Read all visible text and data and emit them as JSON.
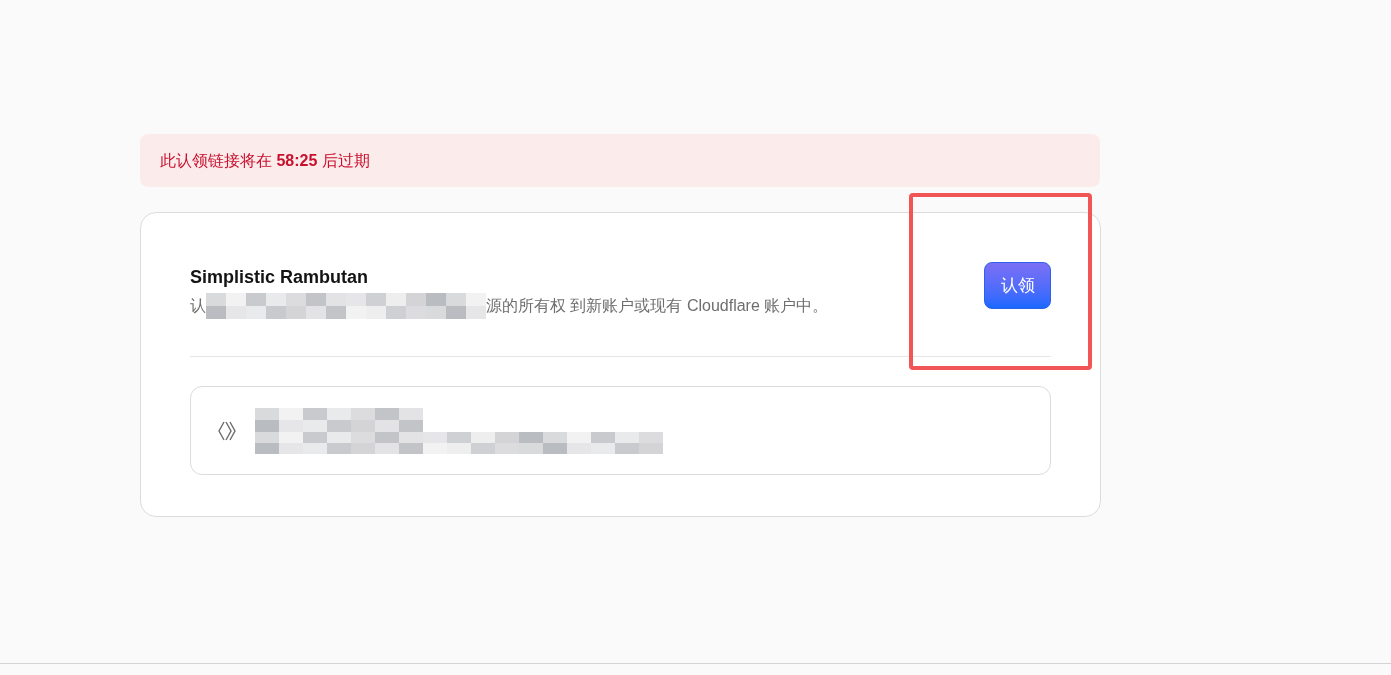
{
  "alert": {
    "message": "此认领链接将在 **58:25** 后过期"
  },
  "card": {
    "title": "Simplistic Rambutan",
    "description_start": "认",
    "description_end": "源的所有权 到新账户或现有 Cloudflare 账户中。",
    "claim_button": {
      "label": "认领",
      "highlighted": true
    }
  }
}
